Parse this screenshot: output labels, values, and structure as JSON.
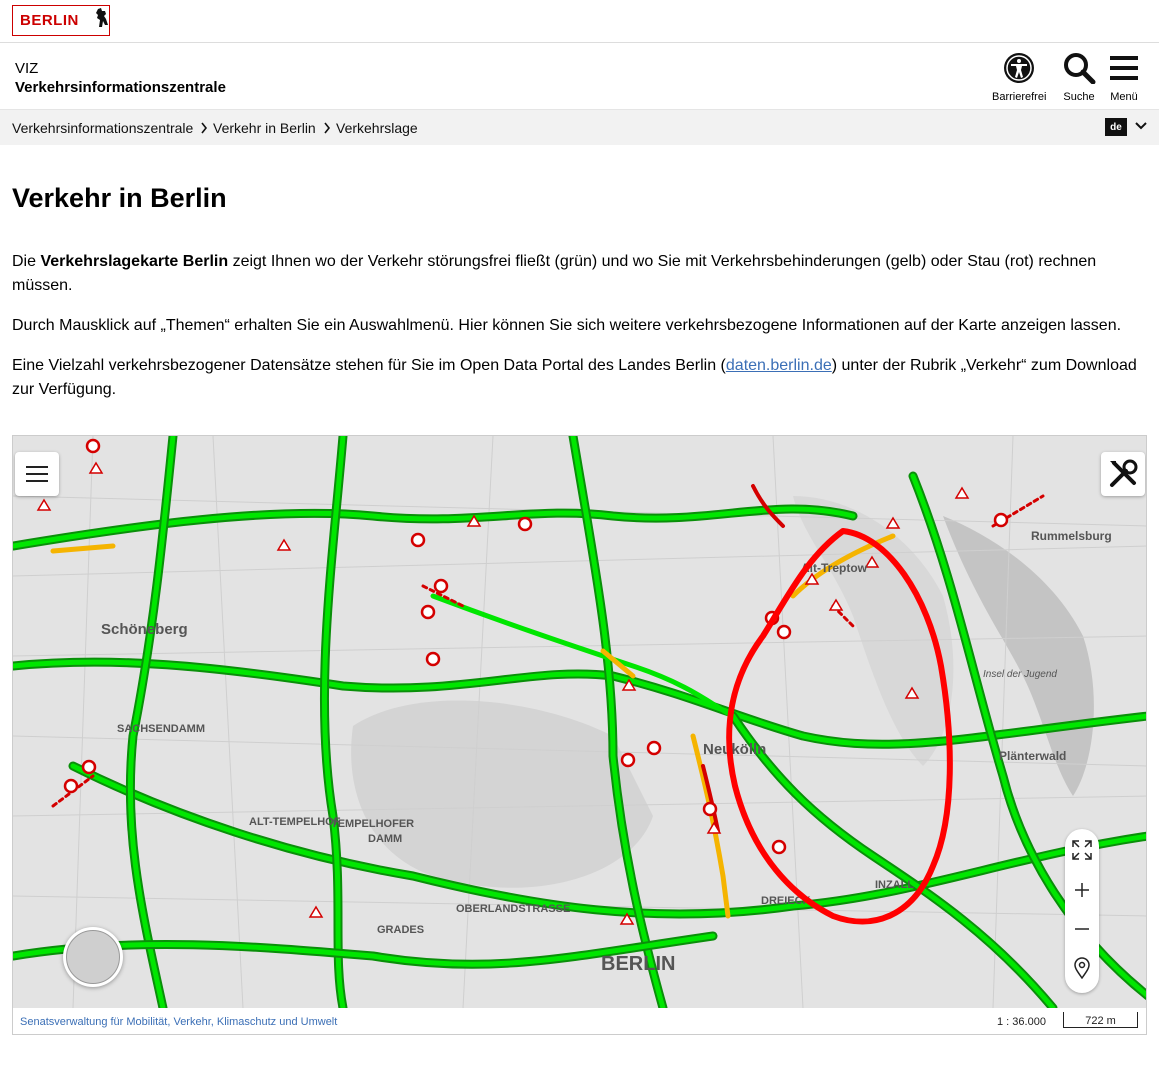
{
  "logo": {
    "text": "BERLIN"
  },
  "header": {
    "subtitle": "VIZ",
    "title": "Verkehrsinformationszentrale",
    "buttons": {
      "accessibility": "Barrierefrei",
      "search": "Suche",
      "menu": "Menü"
    }
  },
  "breadcrumb": {
    "items": [
      "Verkehrsinformationszentrale",
      "Verkehr in Berlin",
      "Verkehrslage"
    ],
    "language": "de"
  },
  "page": {
    "heading": "Verkehr in Berlin",
    "p1_a": "Die ",
    "p1_bold": "Verkehrslagekarte Berlin",
    "p1_b": " zeigt Ihnen wo der Verkehr störungsfrei fließt (grün) und wo Sie mit Verkehrsbehinderungen (gelb) oder Stau (rot) rechnen müssen.",
    "p2": "Durch Mausklick auf „Themen“ erhalten Sie ein Auswahlmenü. Hier können Sie sich weitere verkehrsbezogene Informationen auf der Karte anzeigen lassen.",
    "p3_a": "Eine Vielzahl verkehrsbezogener Datensätze stehen für Sie im Open Data Portal des Landes Berlin (",
    "p3_link": "daten.berlin.de",
    "p3_b": ") unter der Rubrik „Verkehr“ zum Download zur Verfügung."
  },
  "map": {
    "labels": {
      "schoeneberg": "Schöneberg",
      "sachsendamm": "SACHSENDAMM",
      "tempelhofer_damm_1": "TEMPELHOFER",
      "tempelhofer_damm_2": "DAMM",
      "alt_treptow": "Alt-Treptow",
      "neukoelln": "Neukölln",
      "rummelsburg": "Rummelsburg",
      "insel_der_jugend": "Insel der Jugend",
      "plaenterwald": "Plänterwald",
      "oberlandstrasse": "OBERLANDSTRASSE",
      "dreieck": "DREIECK",
      "grades": "GRADES",
      "alt_tempelhof": "ALT-TEMPELHOF",
      "berlin_label": "BERLIN",
      "inzalle": "INZALL"
    },
    "colors": {
      "free": "#00e600",
      "slow": "#f5b400",
      "jam": "#d40000",
      "annotation": "#ff0000"
    },
    "footer": {
      "attribution": "Senatsverwaltung für Mobilität, Verkehr, Klimaschutz und Umwelt",
      "scale": "1 : 36.000",
      "scale_bar": "722 m"
    },
    "icons": [
      "menu-icon",
      "tools-icon",
      "fullscreen-icon",
      "zoom-in-icon",
      "zoom-out-icon",
      "locate-icon",
      "overview-map"
    ]
  }
}
